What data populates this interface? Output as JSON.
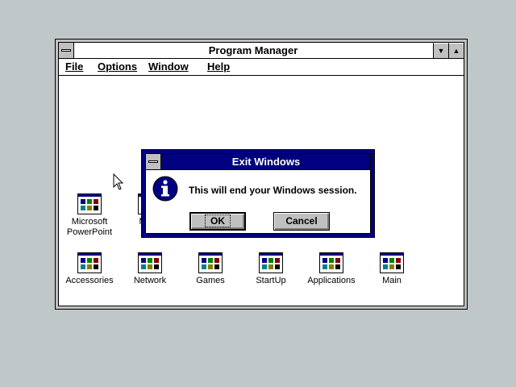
{
  "window": {
    "title": "Program Manager",
    "menu": [
      "File",
      "Options",
      "Window",
      "Help"
    ]
  },
  "groups_row1": [
    {
      "label": "Microsoft\nPowerPoint",
      "icon": "group-icon"
    },
    {
      "label": "Micro",
      "icon": "group-icon"
    },
    {
      "label": "",
      "icon": "group-icon"
    }
  ],
  "groups_row2": [
    {
      "label": "Accessories",
      "icon": "group-icon"
    },
    {
      "label": "Network",
      "icon": "group-icon"
    },
    {
      "label": "Games",
      "icon": "group-icon"
    },
    {
      "label": "StartUp",
      "icon": "group-icon"
    },
    {
      "label": "Applications",
      "icon": "group-icon"
    },
    {
      "label": "Main",
      "icon": "group-icon"
    }
  ],
  "dialog": {
    "title": "Exit Windows",
    "message": "This will end your Windows session.",
    "ok_label": "OK",
    "cancel_label": "Cancel",
    "icon": "info-icon"
  },
  "colors": {
    "desktop": "#c0c7c8",
    "title_active": "#000080"
  }
}
